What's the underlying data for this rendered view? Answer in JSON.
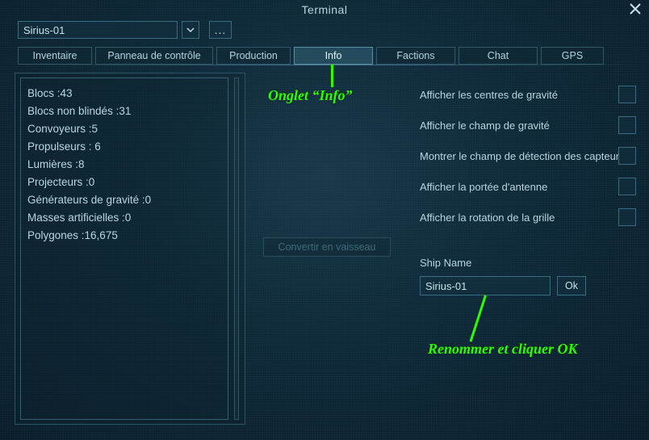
{
  "window": {
    "title": "Terminal"
  },
  "ship_select": {
    "value": "Sirius-01"
  },
  "more_button": "...",
  "tabs": [
    {
      "label": "Inventaire"
    },
    {
      "label": "Panneau de contrôle"
    },
    {
      "label": "Production"
    },
    {
      "label": "Info",
      "active": true
    },
    {
      "label": "Factions"
    },
    {
      "label": "Chat"
    },
    {
      "label": "GPS"
    }
  ],
  "stats": [
    "Blocs :43",
    "Blocs non blindés :31",
    "Convoyeurs :5",
    "Propulseurs : 6",
    "Lumières :8",
    "Projecteurs :0",
    "Générateurs de gravité :0",
    "Masses artificielles :0",
    "Polygones :16,675"
  ],
  "convert_label": "Convertir en vaisseau",
  "options": [
    "Afficher les centres de gravité",
    "Afficher le champ de gravité",
    "Montrer le champ de détection des capteurs",
    "Afficher la portée d'antenne",
    "Afficher la rotation de la grille"
  ],
  "ship_name": {
    "label": "Ship Name",
    "value": "Sirius-01",
    "ok": "Ok"
  },
  "annotations": {
    "info_tab": "Onglet “Info”",
    "rename": "Renommer et cliquer OK"
  },
  "colors": {
    "annotation": "#2cff00",
    "accent": "#3a6b80"
  }
}
